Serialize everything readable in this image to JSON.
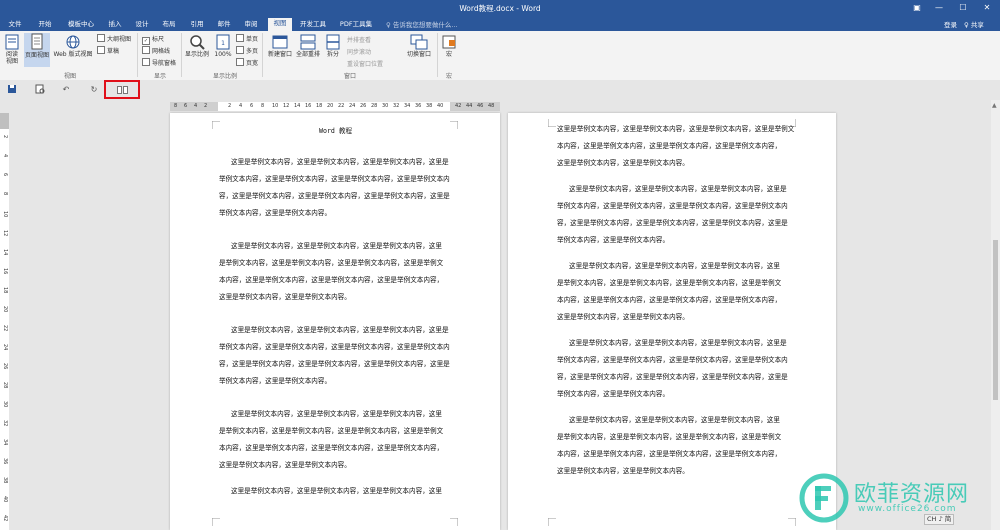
{
  "window": {
    "title": "Word教程.docx - Word",
    "controls": [
      "▣",
      "—",
      "☐",
      "✕"
    ]
  },
  "tabs": [
    "文件",
    "开始",
    "模板中心",
    "插入",
    "设计",
    "布局",
    "引用",
    "邮件",
    "审阅",
    "视图",
    "开发工具",
    "PDF工具集"
  ],
  "active_tab_index": 9,
  "tell_me": "♀ 告诉我您想要做什么...",
  "account": {
    "login": "登录",
    "share": "♀ 共享"
  },
  "ribbon": {
    "views": {
      "read_line1": "阅读",
      "read_line2": "视图",
      "print": "页面视图",
      "web": "Web 版式视图",
      "outline": "大纲视图",
      "draft": "草稿",
      "group": "视图"
    },
    "show": {
      "ruler": "标尺",
      "gridlines": "网格线",
      "nav": "导航窗格",
      "group": "显示"
    },
    "zoom": {
      "zoom": "显示比例",
      "hundred": "100%",
      "one_page": "单页",
      "multi_page": "多页",
      "page_width": "页宽",
      "group": "显示比例"
    },
    "window": {
      "new": "新建窗口",
      "arrange": "全部重排",
      "split": "拆分",
      "side": "并排查看",
      "sync": "同步滚动",
      "reset": "重设窗口位置",
      "switch": "切换窗口",
      "group": "窗口"
    },
    "macro": {
      "label": "宏",
      "group": "宏"
    }
  },
  "ruler": {
    "left_ticks": [
      "8",
      "6",
      "4",
      "2"
    ],
    "ticks": [
      "2",
      "4",
      "6",
      "8",
      "10",
      "12",
      "14",
      "16",
      "18",
      "20",
      "22",
      "24",
      "26",
      "28",
      "30",
      "32",
      "34",
      "36",
      "38",
      "40"
    ],
    "right_ticks": [
      "42",
      "44",
      "46",
      "48"
    ],
    "vticks": [
      "2",
      "4",
      "6",
      "8",
      "10",
      "12",
      "14",
      "16",
      "18",
      "20",
      "22",
      "24",
      "26",
      "28",
      "30",
      "32",
      "34",
      "36",
      "38",
      "40",
      "42"
    ]
  },
  "doc": {
    "heading": "Word 教程",
    "p1": [
      "这里是举例文本内容，这里是举例文本内容，这里是举例文本内容，这里是",
      "举例文本内容，这里是举例文本内容，这里是举例文本内容，这里是举例文本内",
      "容，这里是举例文本内容，这里是举例文本内容，这里是举例文本内容，这里是",
      "举例文本内容，这里是举例文本内容。"
    ],
    "p2": [
      "这里是举例文本内容，这里是举例文本内容，这里是举例文本内容，这里",
      "是举例文本内容，这里是举例文本内容，这里是举例文本内容，这里是举例文",
      "本内容，这里是举例文本内容，这里是举例文本内容，这里是举例文本内容，",
      "这里是举例文本内容，这里是举例文本内容。"
    ],
    "right_cont": [
      "这里是举例文本内容，这里是举例文本内容，这里是举例文本内容，这里是举例文",
      "本内容，这里是举例文本内容，这里是举例文本内容，这里是举例文本内容，",
      "这里是举例文本内容，这里是举例文本内容。"
    ],
    "last_line": "这里是举例文本内容，这里是举例文本内容，这里是举例文本内容，这里"
  },
  "status": {
    "ime": "CH ♪ 简"
  },
  "watermark": {
    "name": "欧菲资源网",
    "url": "www.office26.com"
  },
  "colors": {
    "brand": "#2b579a",
    "highlight": "#e0101a",
    "watermark": "#2ec7b0"
  }
}
